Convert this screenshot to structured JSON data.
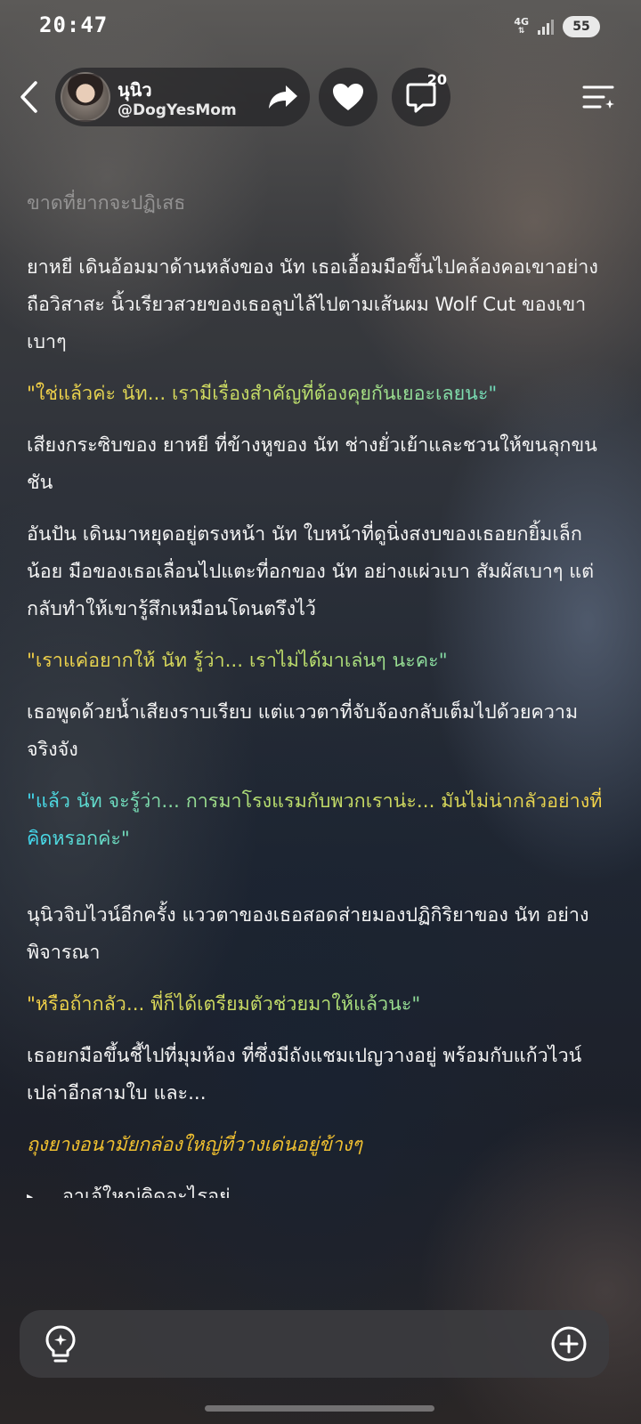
{
  "status_bar": {
    "time": "20:47",
    "network": "4G",
    "battery": "55"
  },
  "header": {
    "author_name": "นุนิว",
    "author_handle": "@DogYesMom",
    "comment_count": "20"
  },
  "content": {
    "faded_line": "ขาดที่ยากจะปฏิเสธ",
    "paragraphs": [
      "ยาหยี เดินอ้อมมาด้านหลังของ นัท เธอเอื้อมมือขึ้นไปคล้องคอเขาอย่างถือวิสาสะ นิ้วเรียวสวยของเธอลูบไล้ไปตามเส้นผม Wolf Cut ของเขาเบาๆ",
      "\"ใช่แล้วค่ะ นัท... เรามีเรื่องสำคัญที่ต้องคุยกันเยอะเลยนะ\"",
      "เสียงกระซิบของ ยาหยี ที่ข้างหูของ นัท ช่างยั่วเย้าและชวนให้ขนลุกขนชัน",
      "อันปัน เดินมาหยุดอยู่ตรงหน้า นัท ใบหน้าที่ดูนิ่งสงบของเธอยกยิ้มเล็กน้อย มือของเธอเลื่อนไปแตะที่อกของ นัท อย่างแผ่วเบา สัมผัสเบาๆ แต่กลับทำให้เขารู้สึกเหมือนโดนตรึงไว้",
      "\"เราแค่อยากให้ นัท รู้ว่า... เราไม่ได้มาเล่นๆ นะคะ\"",
      "เธอพูดด้วยน้ำเสียงราบเรียบ แต่แววตาที่จับจ้องกลับเต็มไปด้วยความจริงจัง",
      "\"แล้ว นัท จะรู้ว่า... การมาโรงแรมกับพวกเราน่ะ... มันไม่น่ากลัวอย่างที่คิดหรอกค่ะ\"",
      "นุนิวจิบไวน์อีกครั้ง แววตาของเธอสอดส่ายมองปฏิกิริยาของ นัท อย่างพิจารณา",
      "\"หรือถ้ากลัว... พี่ก็ได้เตรียมตัวช่วยมาให้แล้วนะ\"",
      "เธอยกมือขึ้นชี้ไปที่มุมห้อง ที่ซึ่งมีถังแชมเปญวางอยู่ พร้อมกับแก้วไวน์เปล่าอีกสามใบ และ...",
      "ถุงยางอนามัยกล่องใหญ่ที่วางเด่นอยู่ข้างๆ"
    ],
    "bullet": "อาเจ้ใหญ่คิดอะไรอยู่"
  },
  "colors": {
    "dialogue_yellow": "#f5d046",
    "dialogue_cyan": "#40d8f0",
    "italic_yellow": "#f0c030"
  },
  "icons": [
    "back-icon",
    "share-icon",
    "heart-icon",
    "comment-icon",
    "menu-icon",
    "lightbulb-icon",
    "plus-circle-icon"
  ]
}
